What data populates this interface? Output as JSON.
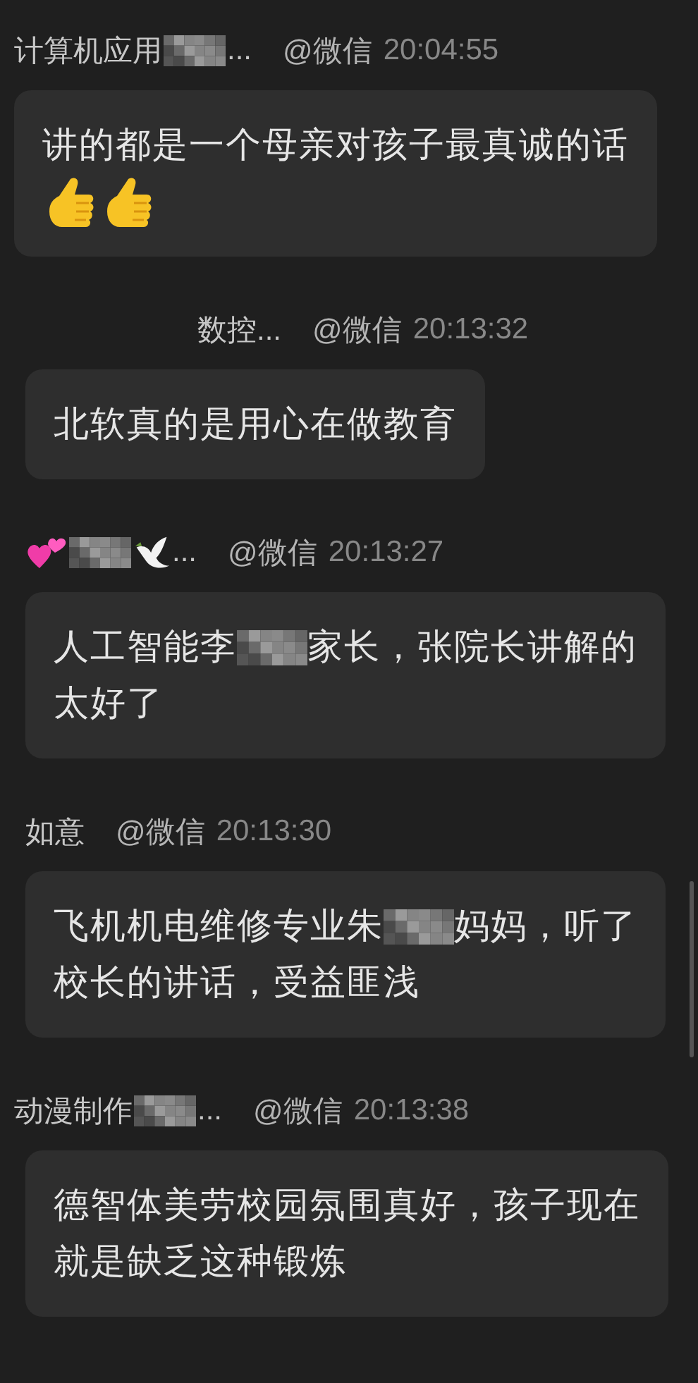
{
  "messages": [
    {
      "sender": [
        {
          "kind": "text",
          "text": "计算机应用"
        },
        {
          "kind": "mosaic"
        },
        {
          "kind": "text",
          "text": "..."
        }
      ],
      "source": "@微信",
      "time": "20:04:55",
      "lines": [
        [
          {
            "kind": "text",
            "text": "讲的都是一个母亲对孩子最真诚的话"
          }
        ],
        [
          {
            "kind": "thumbs"
          },
          {
            "kind": "thumbs"
          }
        ]
      ]
    },
    {
      "sender": [
        {
          "kind": "text",
          "text": "数控..."
        }
      ],
      "source": "@微信",
      "time": "20:13:32",
      "lines": [
        [
          {
            "kind": "text",
            "text": "北软真的是用心在做教育"
          }
        ]
      ]
    },
    {
      "sender": [
        {
          "kind": "hearts"
        },
        {
          "kind": "mosaic"
        },
        {
          "kind": "dove"
        },
        {
          "kind": "text",
          "text": "..."
        }
      ],
      "source": "@微信",
      "time": "20:13:27",
      "lines": [
        [
          {
            "kind": "text",
            "text": "人工智能李"
          },
          {
            "kind": "mosaic"
          },
          {
            "kind": "text",
            "text": "家长，张院长讲解的"
          }
        ],
        [
          {
            "kind": "text",
            "text": "太好了"
          }
        ]
      ]
    },
    {
      "sender": [
        {
          "kind": "text",
          "text": "如意"
        }
      ],
      "source": "@微信",
      "time": "20:13:30",
      "lines": [
        [
          {
            "kind": "text",
            "text": "飞机机电维修专业朱"
          },
          {
            "kind": "mosaic"
          },
          {
            "kind": "text",
            "text": "妈妈，听了"
          }
        ],
        [
          {
            "kind": "text",
            "text": "校长的讲话，受益匪浅"
          }
        ]
      ]
    },
    {
      "sender": [
        {
          "kind": "text",
          "text": "动漫制作"
        },
        {
          "kind": "mosaic"
        },
        {
          "kind": "text",
          "text": "..."
        }
      ],
      "source": "@微信",
      "time": "20:13:38",
      "lines": [
        [
          {
            "kind": "text",
            "text": "德智体美劳校园氛围真好，孩子现在"
          }
        ],
        [
          {
            "kind": "text",
            "text": "就是缺乏这种锻炼"
          }
        ]
      ]
    }
  ]
}
